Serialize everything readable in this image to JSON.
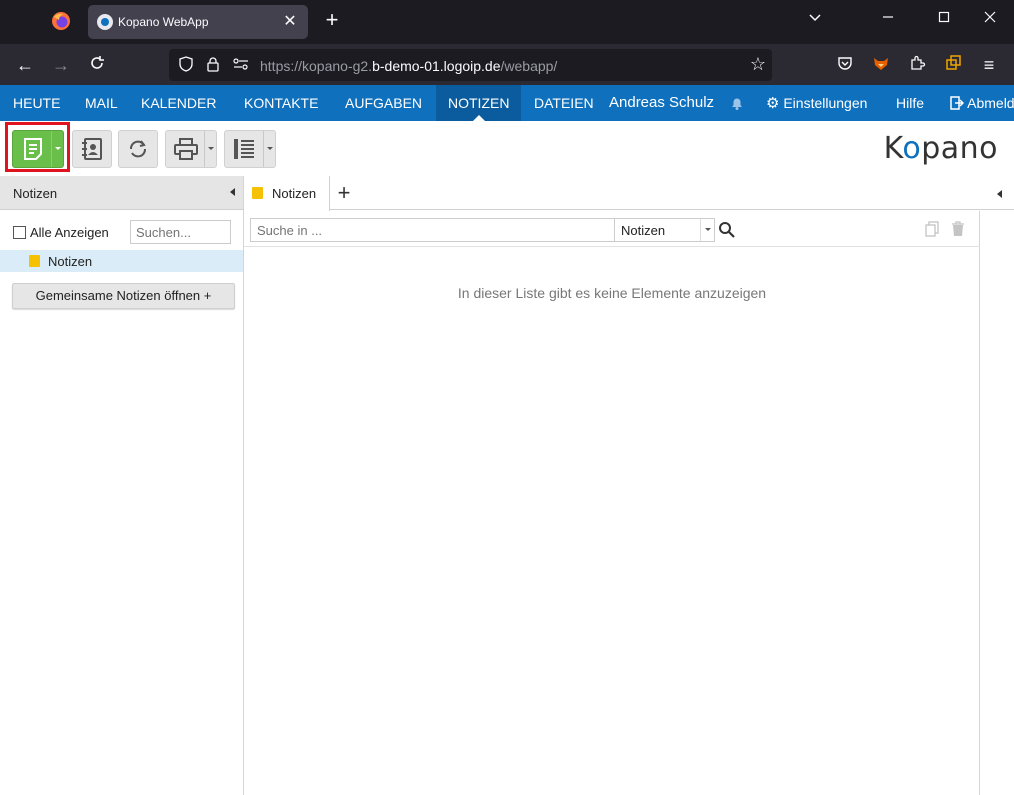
{
  "browser": {
    "tab_title": "Kopano WebApp",
    "url_prefix": "https://kopano-g2.",
    "url_host": "b-demo-01.logoip.de",
    "url_path": "/webapp/"
  },
  "menu": {
    "items": [
      "HEUTE",
      "MAIL",
      "KALENDER",
      "KONTAKTE",
      "AUFGABEN",
      "NOTIZEN",
      "DATEIEN"
    ],
    "active": "NOTIZEN",
    "user": "Andreas Schulz",
    "settings": "Einstellungen",
    "help": "Hilfe",
    "logout": "Abmelden"
  },
  "brand": {
    "k": "K",
    "o": "o",
    "rest": "pano"
  },
  "left_panel": {
    "title": "Notizen",
    "show_all": "Alle Anzeigen",
    "search_placeholder": "Suchen...",
    "folder": "Notizen",
    "shared_button": "Gemeinsame Notizen öffnen +"
  },
  "main": {
    "tab_label": "Notizen",
    "search_placeholder": "Suche in ...",
    "search_scope": "Notizen",
    "empty_message": "In dieser Liste gibt es keine Elemente anzuzeigen"
  },
  "colors": {
    "menubar": "#0f70bd",
    "new_button": "#6abf4b",
    "highlight": "#e0141e",
    "folder": "#f5c100"
  }
}
